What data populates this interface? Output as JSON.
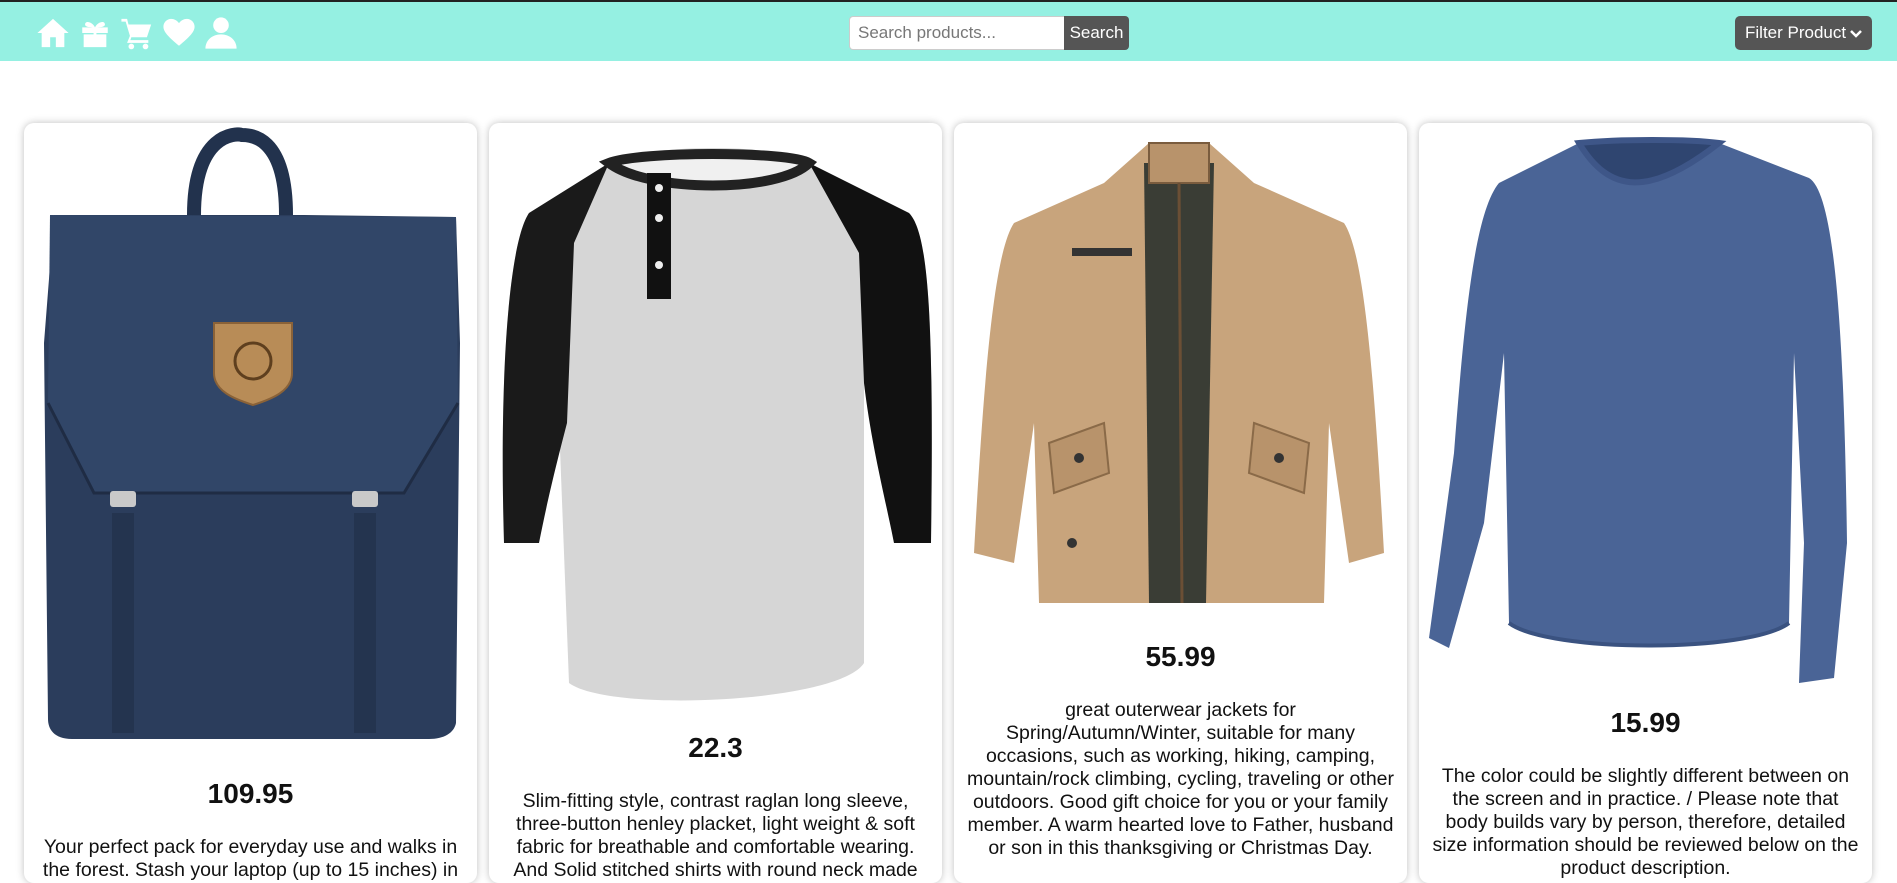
{
  "nav": {
    "icons": [
      "home-icon",
      "gift-icon",
      "cart-icon",
      "heart-icon",
      "user-icon"
    ]
  },
  "search": {
    "placeholder": "Search products...",
    "value": "",
    "button_label": "Search"
  },
  "filter": {
    "selected": "Filter Product"
  },
  "products": [
    {
      "image": "backpack-image",
      "price": "109.95",
      "description": "Your perfect pack for everyday use and walks in the forest. Stash your laptop (up to 15 inches) in"
    },
    {
      "image": "henley-shirt-image",
      "price": "22.3",
      "description": "Slim-fitting style, contrast raglan long sleeve, three-button henley placket, light weight & soft fabric for breathable and comfortable wearing. And Solid stitched shirts with round neck made"
    },
    {
      "image": "jacket-image",
      "price": "55.99",
      "description": "great outerwear jackets for Spring/Autumn/Winter, suitable for many occasions, such as working, hiking, camping, mountain/rock climbing, cycling, traveling or other outdoors. Good gift choice for you or your family member. A warm hearted love to Father, husband or son in this thanksgiving or Christmas Day."
    },
    {
      "image": "long-sleeve-tshirt-image",
      "price": "15.99",
      "description": "The color could be slightly different between on the screen and in practice. / Please note that body builds vary by person, therefore, detailed size information should be reviewed below on the product description."
    }
  ],
  "colors": {
    "navbar": "#95f0e2",
    "button": "#555555"
  }
}
